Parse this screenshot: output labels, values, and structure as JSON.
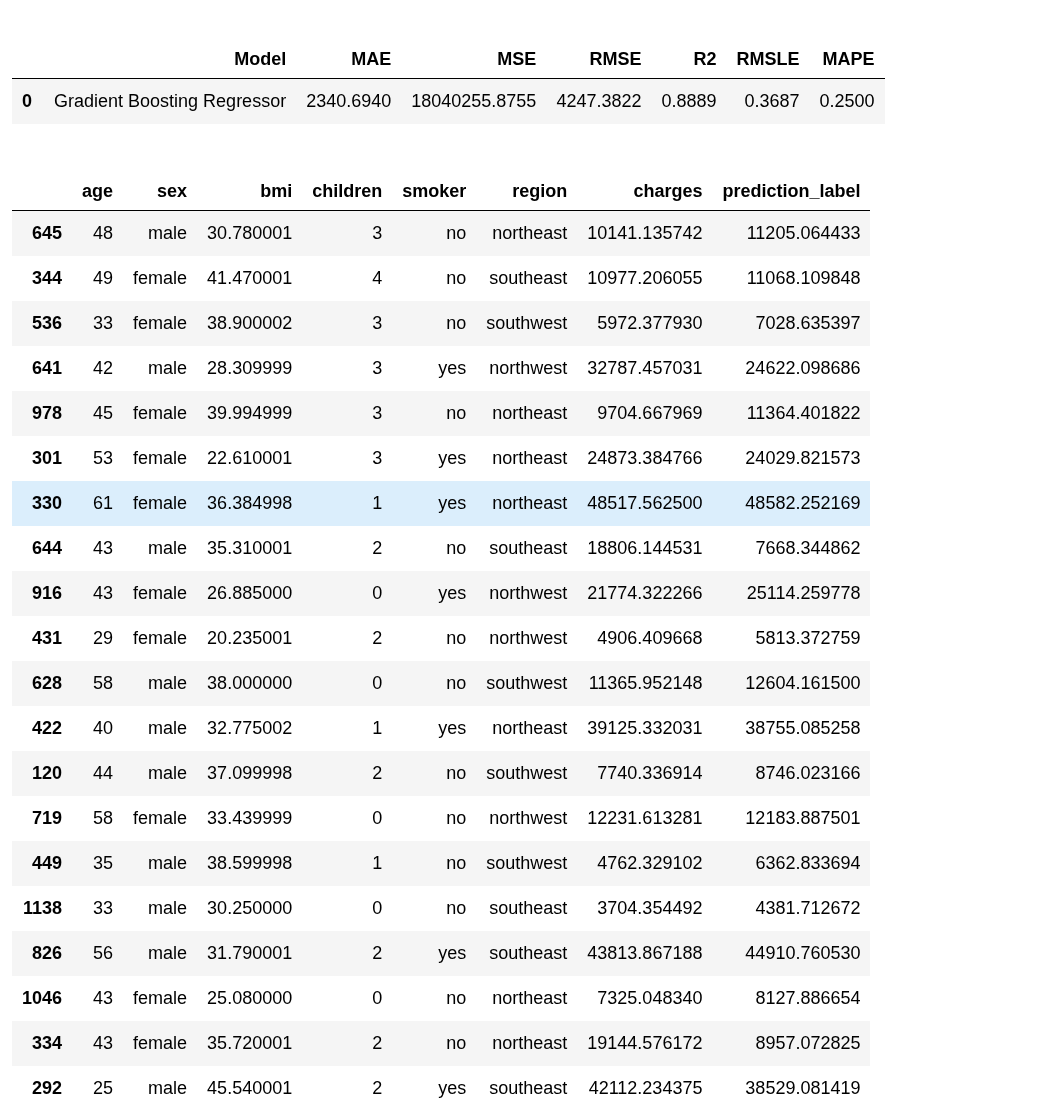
{
  "metrics_table": {
    "columns": [
      "Model",
      "MAE",
      "MSE",
      "RMSE",
      "R2",
      "RMSLE",
      "MAPE"
    ],
    "rows": [
      {
        "index": "0",
        "highlighted": false,
        "cells": [
          "Gradient Boosting Regressor",
          "2340.6940",
          "18040255.8755",
          "4247.3822",
          "0.8889",
          "0.3687",
          "0.2500"
        ]
      }
    ]
  },
  "predictions_table": {
    "columns": [
      "age",
      "sex",
      "bmi",
      "children",
      "smoker",
      "region",
      "charges",
      "prediction_label"
    ],
    "rows": [
      {
        "index": "645",
        "highlighted": false,
        "cells": [
          "48",
          "male",
          "30.780001",
          "3",
          "no",
          "northeast",
          "10141.135742",
          "11205.064433"
        ]
      },
      {
        "index": "344",
        "highlighted": false,
        "cells": [
          "49",
          "female",
          "41.470001",
          "4",
          "no",
          "southeast",
          "10977.206055",
          "11068.109848"
        ]
      },
      {
        "index": "536",
        "highlighted": false,
        "cells": [
          "33",
          "female",
          "38.900002",
          "3",
          "no",
          "southwest",
          "5972.377930",
          "7028.635397"
        ]
      },
      {
        "index": "641",
        "highlighted": false,
        "cells": [
          "42",
          "male",
          "28.309999",
          "3",
          "yes",
          "northwest",
          "32787.457031",
          "24622.098686"
        ]
      },
      {
        "index": "978",
        "highlighted": false,
        "cells": [
          "45",
          "female",
          "39.994999",
          "3",
          "no",
          "northeast",
          "9704.667969",
          "11364.401822"
        ]
      },
      {
        "index": "301",
        "highlighted": false,
        "cells": [
          "53",
          "female",
          "22.610001",
          "3",
          "yes",
          "northeast",
          "24873.384766",
          "24029.821573"
        ]
      },
      {
        "index": "330",
        "highlighted": true,
        "cells": [
          "61",
          "female",
          "36.384998",
          "1",
          "yes",
          "northeast",
          "48517.562500",
          "48582.252169"
        ]
      },
      {
        "index": "644",
        "highlighted": false,
        "cells": [
          "43",
          "male",
          "35.310001",
          "2",
          "no",
          "southeast",
          "18806.144531",
          "7668.344862"
        ]
      },
      {
        "index": "916",
        "highlighted": false,
        "cells": [
          "43",
          "female",
          "26.885000",
          "0",
          "yes",
          "northwest",
          "21774.322266",
          "25114.259778"
        ]
      },
      {
        "index": "431",
        "highlighted": false,
        "cells": [
          "29",
          "female",
          "20.235001",
          "2",
          "no",
          "northwest",
          "4906.409668",
          "5813.372759"
        ]
      },
      {
        "index": "628",
        "highlighted": false,
        "cells": [
          "58",
          "male",
          "38.000000",
          "0",
          "no",
          "southwest",
          "11365.952148",
          "12604.161500"
        ]
      },
      {
        "index": "422",
        "highlighted": false,
        "cells": [
          "40",
          "male",
          "32.775002",
          "1",
          "yes",
          "northeast",
          "39125.332031",
          "38755.085258"
        ]
      },
      {
        "index": "120",
        "highlighted": false,
        "cells": [
          "44",
          "male",
          "37.099998",
          "2",
          "no",
          "southwest",
          "7740.336914",
          "8746.023166"
        ]
      },
      {
        "index": "719",
        "highlighted": false,
        "cells": [
          "58",
          "female",
          "33.439999",
          "0",
          "no",
          "northwest",
          "12231.613281",
          "12183.887501"
        ]
      },
      {
        "index": "449",
        "highlighted": false,
        "cells": [
          "35",
          "male",
          "38.599998",
          "1",
          "no",
          "southwest",
          "4762.329102",
          "6362.833694"
        ]
      },
      {
        "index": "1138",
        "highlighted": false,
        "cells": [
          "33",
          "male",
          "30.250000",
          "0",
          "no",
          "southeast",
          "3704.354492",
          "4381.712672"
        ]
      },
      {
        "index": "826",
        "highlighted": false,
        "cells": [
          "56",
          "male",
          "31.790001",
          "2",
          "yes",
          "southeast",
          "43813.867188",
          "44910.760530"
        ]
      },
      {
        "index": "1046",
        "highlighted": false,
        "cells": [
          "43",
          "female",
          "25.080000",
          "0",
          "no",
          "northeast",
          "7325.048340",
          "8127.886654"
        ]
      },
      {
        "index": "334",
        "highlighted": false,
        "cells": [
          "43",
          "female",
          "35.720001",
          "2",
          "no",
          "northeast",
          "19144.576172",
          "8957.072825"
        ]
      },
      {
        "index": "292",
        "highlighted": false,
        "cells": [
          "25",
          "male",
          "45.540001",
          "2",
          "yes",
          "southeast",
          "42112.234375",
          "38529.081419"
        ]
      }
    ]
  }
}
